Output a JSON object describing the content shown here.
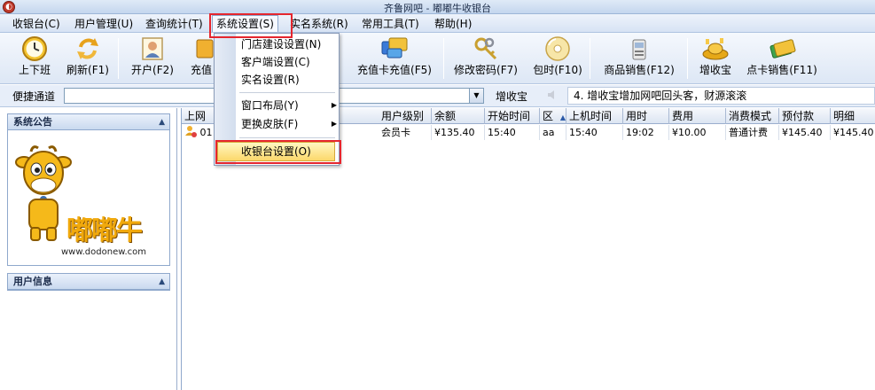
{
  "window": {
    "title": "齐鲁网吧 - 嘟嘟牛收银台"
  },
  "menubar": [
    {
      "label": "收银台(C)"
    },
    {
      "label": "用户管理(U)"
    },
    {
      "label": "查询统计(T)"
    },
    {
      "label": "系统设置(S)"
    },
    {
      "label": "实名系统(R)"
    },
    {
      "label": "常用工具(T)"
    },
    {
      "label": "帮助(H)"
    }
  ],
  "toolbar": [
    {
      "label": "上下班",
      "icon": "clock-icon"
    },
    {
      "label": "刷新(F1)",
      "icon": "refresh-icon"
    },
    {
      "label": "开户(F2)",
      "icon": "user-card-icon"
    },
    {
      "label": "充值",
      "icon": "recharge-icon"
    },
    {
      "label": "充值卡充值(F5)",
      "icon": "card-recharge-icon"
    },
    {
      "label": "修改密码(F7)",
      "icon": "keys-icon"
    },
    {
      "label": "包时(F10)",
      "icon": "disc-icon"
    },
    {
      "label": "商品销售(F12)",
      "icon": "goods-icon"
    },
    {
      "label": "增收宝",
      "icon": "gold-ingot-icon"
    },
    {
      "label": "点卡销售(F11)",
      "icon": "point-card-icon"
    }
  ],
  "quickbar": {
    "label": "便捷通道",
    "combo_value": "",
    "zsb_label": "增收宝",
    "ticker": "4. 增收宝增加网吧回头客，财源滚滚"
  },
  "panels": {
    "announcement": {
      "title": "系统公告",
      "brand": "嘟嘟牛",
      "url": "www.dodonew.com"
    },
    "user_info": {
      "title": "用户信息"
    }
  },
  "grid": {
    "columns": [
      "上网",
      "用户级别",
      "余额",
      "开始时间",
      "区",
      "上机时间",
      "用时",
      "费用",
      "消费模式",
      "预付款",
      "明细"
    ],
    "rows": [
      {
        "cells": [
          "01",
          "会员卡",
          "¥135.40",
          "15:40",
          "aa",
          "15:40",
          "19:02",
          "¥10.00",
          "普通计费",
          "¥145.40",
          "¥145.40"
        ]
      }
    ]
  },
  "dropdown": {
    "items": [
      {
        "label": "门店建设设置(N)"
      },
      {
        "label": "客户端设置(C)"
      },
      {
        "label": "实名设置(R)"
      },
      {
        "label": "窗口布局(Y)"
      },
      {
        "label": "更换皮肤(F)"
      },
      {
        "label": "收银台设置(O)"
      }
    ]
  },
  "colors": {
    "highlight": "#e5262e",
    "accent": "#fcd86b"
  }
}
